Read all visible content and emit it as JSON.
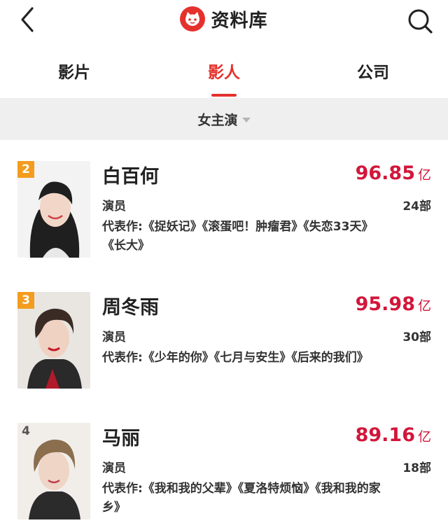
{
  "header": {
    "title": "资料库",
    "back_icon": "chevron-left-icon",
    "search_icon": "search-icon",
    "logo_icon": "cat-logo-icon",
    "brand_color": "#e5312c"
  },
  "tabs": [
    {
      "label": "影片",
      "active": false
    },
    {
      "label": "影人",
      "active": true
    },
    {
      "label": "公司",
      "active": false
    }
  ],
  "filter": {
    "label": "女主演"
  },
  "people": [
    {
      "rank": "2",
      "name": "白百何",
      "score": "96.85",
      "unit": "亿",
      "role": "演员",
      "count": "24部",
      "works": "代表作:《捉妖记》《滚蛋吧！肿瘤君》《失恋33天》《长大》",
      "rank_color": "#f39c1e"
    },
    {
      "rank": "3",
      "name": "周冬雨",
      "score": "95.98",
      "unit": "亿",
      "role": "演员",
      "count": "30部",
      "works": "代表作:《少年的你》《七月与安生》《后来的我们》",
      "rank_color": "#f39c1e"
    },
    {
      "rank": "4",
      "name": "马丽",
      "score": "89.16",
      "unit": "亿",
      "role": "演员",
      "count": "18部",
      "works": "代表作:《我和我的父辈》《夏洛特烦恼》《我和我的家乡》",
      "rank_color": "none"
    }
  ]
}
